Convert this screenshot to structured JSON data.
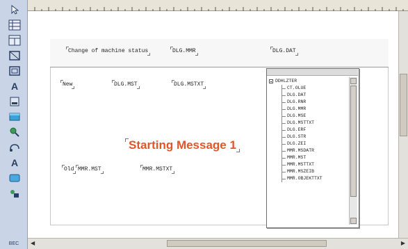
{
  "toolbox": {
    "tools": [
      {
        "name": "select-arrow-icon",
        "glyph": "↖"
      },
      {
        "name": "grid-tool-icon",
        "glyph": ""
      },
      {
        "name": "table-tool-icon",
        "glyph": ""
      },
      {
        "name": "frame-tool-icon",
        "glyph": ""
      },
      {
        "name": "group-tool-icon",
        "glyph": ""
      },
      {
        "name": "text-tool-icon",
        "glyph": "A"
      },
      {
        "name": "field-tool-icon",
        "glyph": ""
      },
      {
        "name": "image-tool-icon",
        "glyph": ""
      },
      {
        "name": "zoom-tool-icon",
        "glyph": ""
      },
      {
        "name": "link-tool-icon",
        "glyph": ""
      },
      {
        "name": "label-tool-icon",
        "glyph": "A"
      },
      {
        "name": "button-tool-icon",
        "glyph": ""
      },
      {
        "name": "shape-tool-icon",
        "glyph": ""
      }
    ],
    "status": "BEC"
  },
  "header": {
    "change_label": "Change of machine status",
    "field_1": "DLG.MMR",
    "field_2": "DLG.DAT"
  },
  "body_fields": {
    "new_label": "New",
    "dlg_mst": "DLG.MST",
    "dlg_mstxt": "DLG.MSTXT",
    "old_label": "Old",
    "mmr_mst": "MMR.MST",
    "mmr_mstxt": "MMR.MSTXT",
    "starting_message": "Starting Message 1"
  },
  "tree": {
    "root": "DDHLZTER",
    "items": [
      "CT.OLUE",
      "DLG.DAT",
      "DLG.RNR",
      "DLG.MMR",
      "DLG.MSE",
      "DLG.MSTTXT",
      "DLG.ERF",
      "DLG.STR",
      "DLG.ZEI",
      "MMR.MSDATR",
      "MMR.MST",
      "MMR.MSTTXT",
      "MMR.MSZEIB",
      "MMR.OBJEKTTXT"
    ]
  }
}
